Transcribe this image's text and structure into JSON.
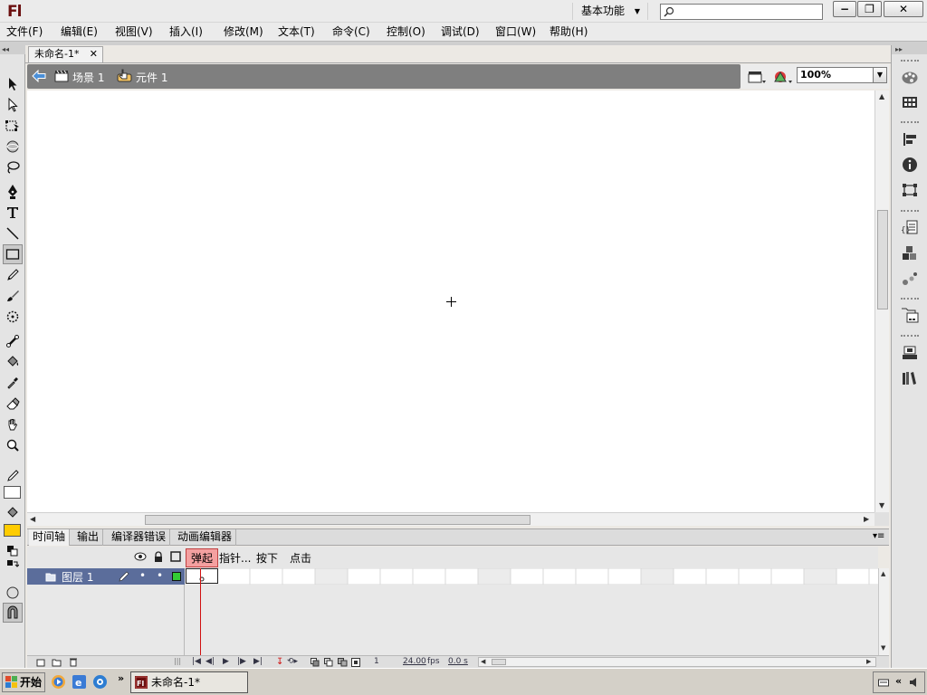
{
  "app": {
    "logo": "Fl",
    "workspace_label": "基本功能",
    "search_placeholder": ""
  },
  "menu": [
    {
      "label": "文件(F)"
    },
    {
      "label": "编辑(E)"
    },
    {
      "label": "视图(V)"
    },
    {
      "label": "插入(I)"
    },
    {
      "label": "修改(M)"
    },
    {
      "label": "文本(T)"
    },
    {
      "label": "命令(C)"
    },
    {
      "label": "控制(O)"
    },
    {
      "label": "调试(D)"
    },
    {
      "label": "窗口(W)"
    },
    {
      "label": "帮助(H)"
    }
  ],
  "document": {
    "tab_title": "未命名-1*",
    "scene_label": "场景 1",
    "symbol_label": "元件 1",
    "zoom": "100%"
  },
  "panel_tabs": [
    "时间轴",
    "输出",
    "编译器错误",
    "动画编辑器"
  ],
  "timeline": {
    "frame_labels": [
      "弹起",
      "指针...",
      "按下",
      "点击"
    ],
    "active_frame_label": "弹起",
    "layer_name": "图层 1",
    "current_frame": "1",
    "fps": "24.00",
    "fps_unit": "fps",
    "elapsed": "0.0 s"
  },
  "colors": {
    "stroke": "#ffffff",
    "fill": "#ffcc00",
    "layer_highlight": "#5b6d9b",
    "playhead": "#d01010",
    "layer_color": "#33cc33"
  },
  "taskbar": {
    "start_label": "开始",
    "task_label": "未命名-1*"
  },
  "tools": [
    "selection-tool-icon",
    "subselection-tool-icon",
    "free-transform-tool-icon",
    "3d-rotation-tool-icon",
    "lasso-tool-icon",
    "pen-tool-icon",
    "text-tool-icon",
    "line-tool-icon",
    "rectangle-tool-icon",
    "pencil-tool-icon",
    "brush-tool-icon",
    "deco-tool-icon",
    "bone-tool-icon",
    "paint-bucket-tool-icon",
    "eyedropper-tool-icon",
    "eraser-tool-icon",
    "hand-tool-icon",
    "zoom-tool-icon"
  ]
}
